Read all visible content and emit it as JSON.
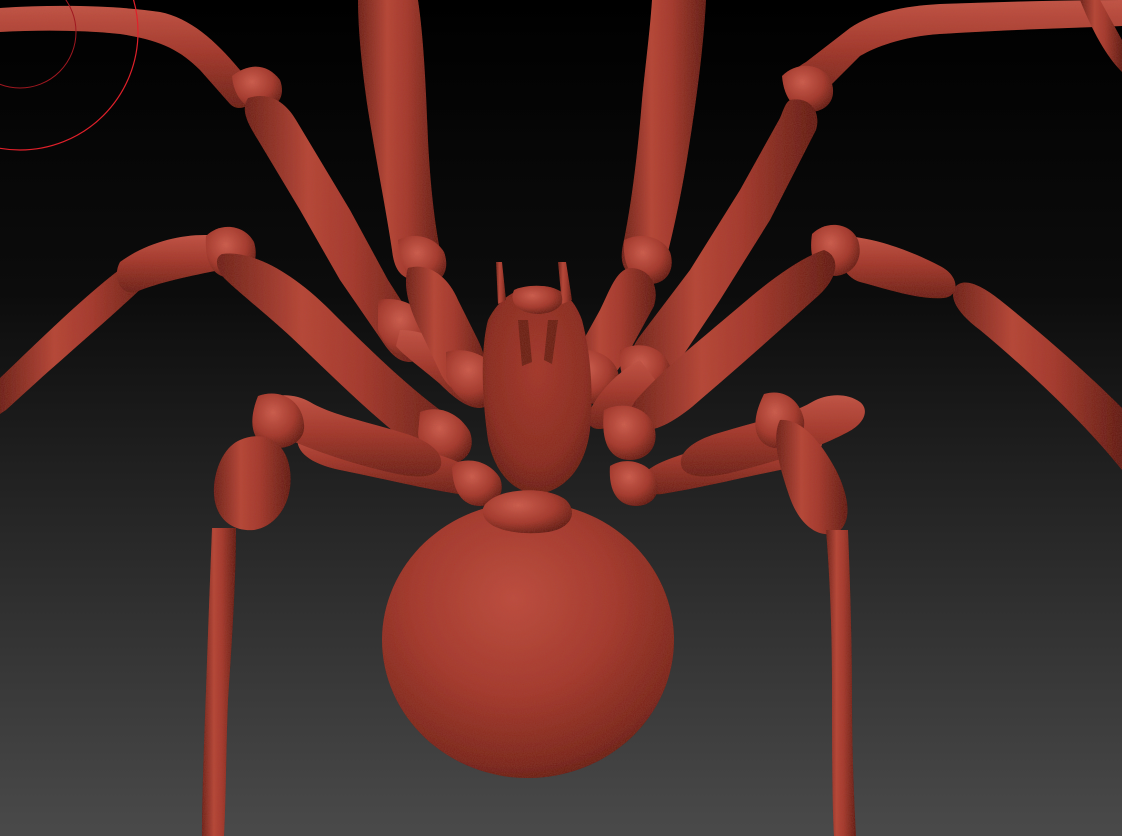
{
  "app": {
    "type": "3d-sculpt-viewport"
  },
  "viewport": {
    "background_top": "#000000",
    "background_bottom": "#4a4a4a",
    "model": {
      "subject": "spider-model-ventral-view",
      "material_color": "#a53a2d",
      "material_highlight": "#c9574a",
      "material_shadow": "#5e1b14"
    },
    "brush_cursor": {
      "color": "#e0202a"
    }
  }
}
